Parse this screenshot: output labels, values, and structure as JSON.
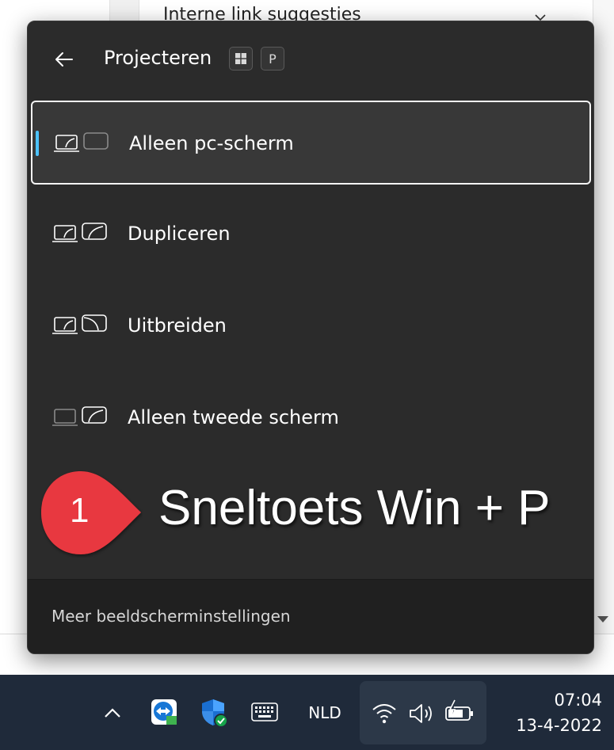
{
  "background": {
    "heading": "Interne link suggesties"
  },
  "flyout": {
    "title": "Projecteren",
    "shortcut_keys": [
      "⊞",
      "P"
    ],
    "options": [
      {
        "label": "Alleen pc-scherm",
        "selected": true
      },
      {
        "label": "Dupliceren",
        "selected": false
      },
      {
        "label": "Uitbreiden",
        "selected": false
      },
      {
        "label": "Alleen tweede scherm",
        "selected": false
      }
    ],
    "footer_link": "Meer beeldscherminstellingen",
    "accent_color": "#4cc2ff"
  },
  "annotation": {
    "number": "1",
    "text": "Sneltoets Win + P",
    "badge_color": "#e8393f"
  },
  "taskbar": {
    "icons": [
      "chevron-up-icon",
      "teamviewer-icon",
      "windows-security-icon",
      "touch-keyboard-icon"
    ],
    "language": "NLD",
    "tray_icons": [
      "wifi-icon",
      "volume-icon",
      "battery-charging-icon"
    ],
    "time": "07:04",
    "date": "13-4-2022"
  }
}
